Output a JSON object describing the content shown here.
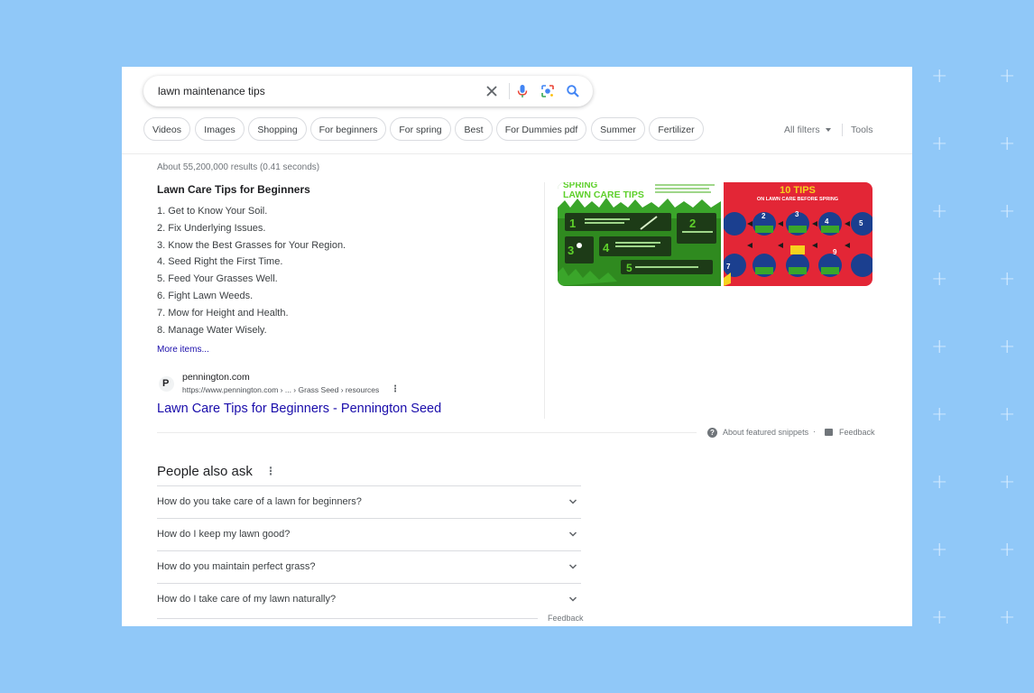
{
  "search": {
    "query": "lawn maintenance tips"
  },
  "icons": {
    "clear": "close-icon",
    "voice": "microphone-icon",
    "lens": "camera-lens-icon",
    "search": "search-icon"
  },
  "filters": {
    "chips": [
      "Videos",
      "Images",
      "Shopping",
      "For beginners",
      "For spring",
      "Best",
      "For Dummies pdf",
      "Summer",
      "Fertilizer"
    ],
    "all_filters": "All filters",
    "tools": "Tools"
  },
  "results": {
    "stats": "About 55,200,000 results (0.41 seconds)",
    "snippet": {
      "title": "Lawn Care Tips for Beginners",
      "items": [
        "1. Get to Know Your Soil.",
        "2. Fix Underlying Issues.",
        "3. Know the Best Grasses for Your Region.",
        "4. Seed Right the First Time.",
        "5. Feed Your Grasses Well.",
        "6. Fight Lawn Weeds.",
        "7. Mow for Height and Health.",
        "8. Manage Water Wisely."
      ],
      "more_items": "More items...",
      "source_logo": "P",
      "source_name": "pennington.com",
      "source_url": "https://www.pennington.com › ... › Grass Seed › resources",
      "result_title": "Lawn Care Tips for Beginners - Pennington Seed"
    },
    "images": [
      {
        "heading": "LAWN CARE TIPS",
        "top": "SPRING",
        "colors": {
          "bg": "#2f8a1f",
          "panel": "#1d3b17",
          "accent": "#5ed02b"
        }
      },
      {
        "heading": "10 TIPS",
        "subheading": "ON LAWN CARE BEFORE SPRING",
        "colors": {
          "bg": "#e32636",
          "accent": "#f6d21e",
          "circle": "#1b3f8f"
        }
      }
    ],
    "about_snippets": "About featured snippets",
    "feedback": "Feedback"
  },
  "paa": {
    "title": "People also ask",
    "questions": [
      "How do you take care of a lawn for beginners?",
      "How do I keep my lawn good?",
      "How do you maintain perfect grass?",
      "How do I take care of my lawn naturally?"
    ],
    "feedback": "Feedback"
  }
}
